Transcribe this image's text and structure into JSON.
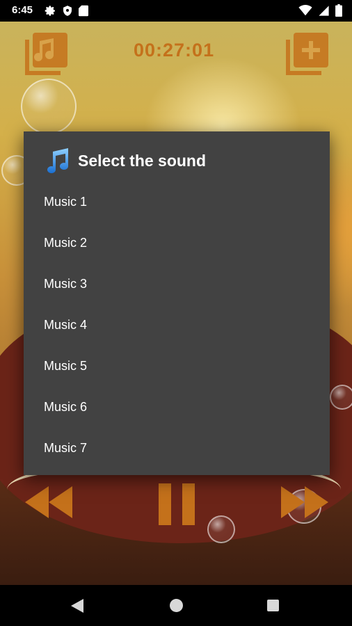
{
  "status_bar": {
    "time": "6:45",
    "icons_left": [
      "gear-icon",
      "shield-icon",
      "sd-card-icon"
    ],
    "icons_right": [
      "wifi-icon",
      "signal-icon",
      "battery-icon"
    ]
  },
  "player": {
    "timer": "00:27:01"
  },
  "dialog": {
    "title": "Select the sound",
    "items": [
      {
        "label": "Music 1"
      },
      {
        "label": "Music 2"
      },
      {
        "label": "Music 3"
      },
      {
        "label": "Music 4"
      },
      {
        "label": "Music 5"
      },
      {
        "label": "Music 6"
      },
      {
        "label": "Music 7"
      }
    ]
  },
  "colors": {
    "dialog_bg": "#424242",
    "accent_orange": "#c4711b",
    "text_white": "#ffffff"
  }
}
